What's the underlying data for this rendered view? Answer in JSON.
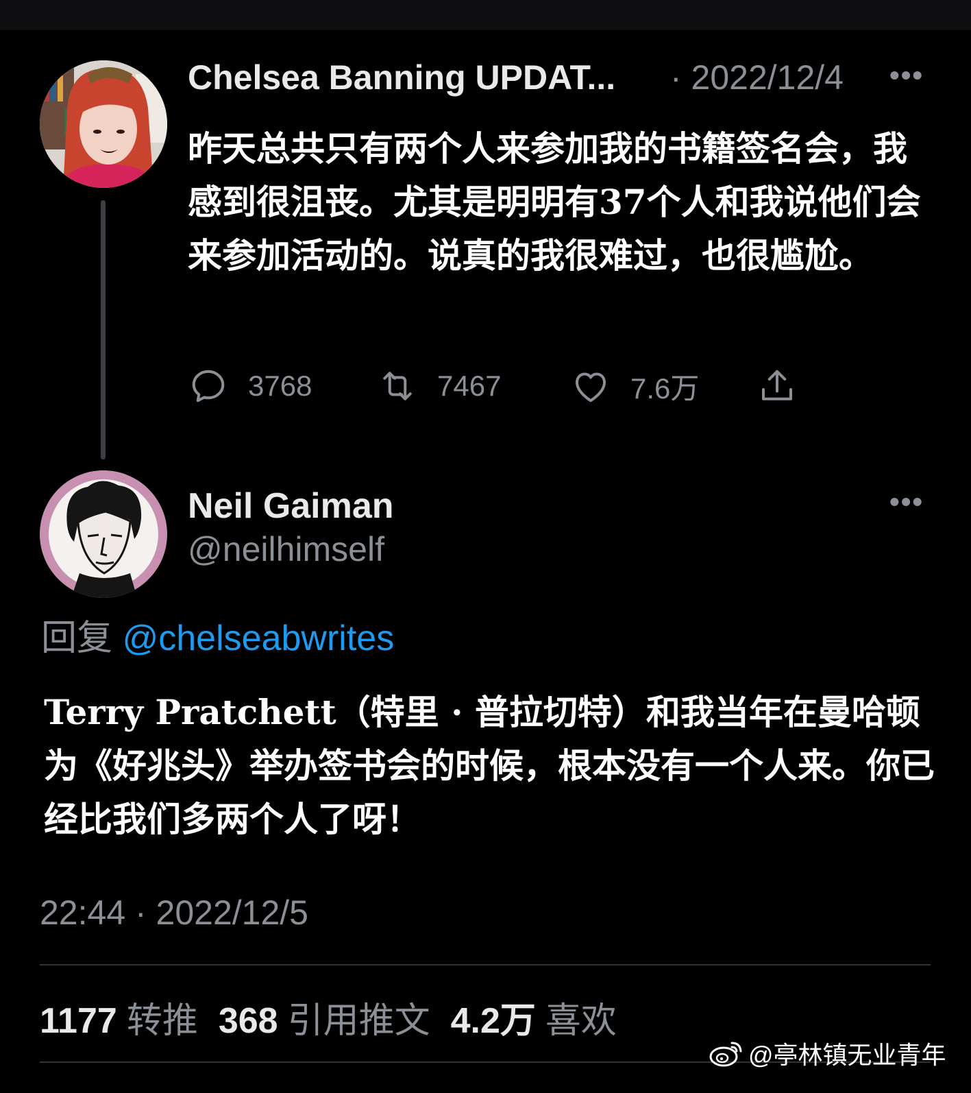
{
  "tweet1": {
    "author_name": "Chelsea Banning UPDAT...",
    "date": "· 2022/12/4",
    "more": "•••",
    "text": "昨天总共只有两个人来参加我的书籍签名会，我感到很沮丧。尤其是明明有37个人和我说他们会来参加活动的。说真的我很难过，也很尴尬。",
    "actions": {
      "replies": "3768",
      "retweets": "7467",
      "likes": "7.6万"
    }
  },
  "tweet2": {
    "author_name": "Neil Gaiman",
    "handle": "@neilhimself",
    "more": "•••",
    "reply_prefix": "回复",
    "reply_mention": "@chelseabwrites",
    "text": "Terry Pratchett（特里 · 普拉切特）和我当年在曼哈顿为《好兆头》举办签书会的时候，根本没有一个人来。你已经比我们多两个人了呀！",
    "timestamp": "22:44 · 2022/12/5",
    "stats": {
      "retweets_count": "1177",
      "retweets_label": "转推",
      "quotes_count": "368",
      "quotes_label": "引用推文",
      "likes_count": "4.2万",
      "likes_label": "喜欢"
    }
  },
  "watermark": {
    "icon": "weibo-icon",
    "text": "@亭林镇无业青年"
  },
  "colors": {
    "background": "#000000",
    "text": "#e7e9ea",
    "muted": "#8b9096",
    "mention": "#1d9bf0"
  }
}
